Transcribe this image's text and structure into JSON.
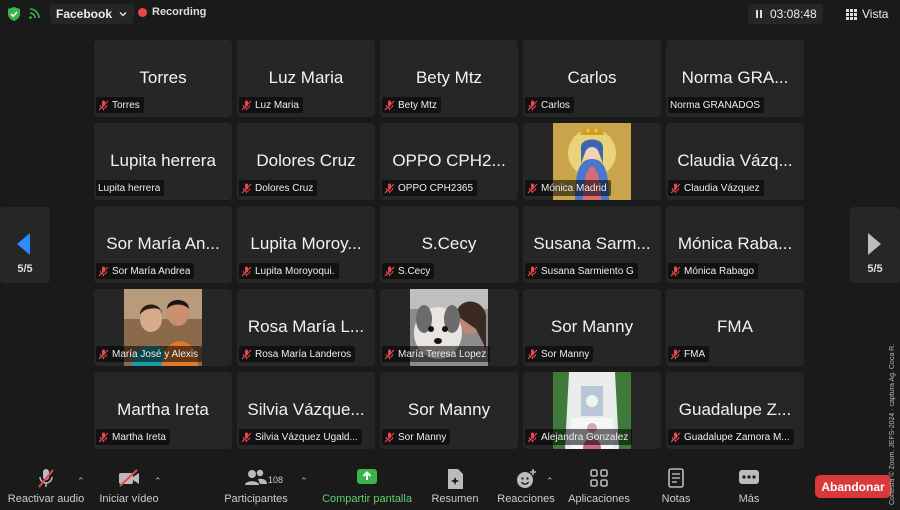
{
  "topbar": {
    "app_name": "Facebook",
    "recording_label": "Recording",
    "timer": "03:08:48",
    "view_label": "Vista"
  },
  "pagination": {
    "left_label": "5/5",
    "right_label": "5/5"
  },
  "participants": [
    {
      "big": "Torres",
      "label": "Torres",
      "muted": true
    },
    {
      "big": "Luz Maria",
      "label": "Luz Maria",
      "muted": true
    },
    {
      "big": "Bety Mtz",
      "label": "Bety Mtz",
      "muted": true
    },
    {
      "big": "Carlos",
      "label": "Carlos",
      "muted": true
    },
    {
      "big": "Norma GRA...",
      "label": "Norma GRANADOS",
      "muted": false
    },
    {
      "big": "Lupita herrera",
      "label": "Lupita herrera",
      "muted": false
    },
    {
      "big": "Dolores Cruz",
      "label": "Dolores Cruz",
      "muted": true
    },
    {
      "big": "OPPO CPH2...",
      "label": "OPPO CPH2365",
      "muted": true
    },
    {
      "big": "",
      "label": "Mónica Madrid",
      "muted": true,
      "photo": "virgin-mary"
    },
    {
      "big": "Claudia Vázq...",
      "label": "Claudia Vázquez",
      "muted": true
    },
    {
      "big": "Sor María An...",
      "label": "Sor María Andrea",
      "muted": true
    },
    {
      "big": "Lupita Moroy...",
      "label": "Lupita Moroyoqui.",
      "muted": true
    },
    {
      "big": "S.Cecy",
      "label": "S.Cecy",
      "muted": true
    },
    {
      "big": "Susana Sarm...",
      "label": "Susana Sarmiento G",
      "muted": true
    },
    {
      "big": "Mónica Raba...",
      "label": "Mónica Rabago",
      "muted": true
    },
    {
      "big": "",
      "label": "María José y Alexis",
      "muted": true,
      "photo": "couple"
    },
    {
      "big": "Rosa María L...",
      "label": "Rosa María Landeros",
      "muted": true
    },
    {
      "big": "",
      "label": "María Teresa Lopez",
      "muted": true,
      "photo": "dog"
    },
    {
      "big": "Sor Manny",
      "label": "Sor Manny",
      "muted": true
    },
    {
      "big": "FMA",
      "label": "FMA",
      "muted": true
    },
    {
      "big": "Martha Ireta",
      "label": "Martha Ireta",
      "muted": true
    },
    {
      "big": "Silvia Vázque...",
      "label": "Silvia Vázquez Ugald...",
      "muted": true
    },
    {
      "big": "Sor Manny",
      "label": "Sor Manny",
      "muted": true
    },
    {
      "big": "",
      "label": "Alejandra Gonzalez",
      "muted": true,
      "photo": "altar"
    },
    {
      "big": "Guadalupe Z...",
      "label": "Guadalupe Zamora M...",
      "muted": true
    }
  ],
  "toolbar": {
    "unmute": "Reactivar audio",
    "start_video": "Iniciar vídeo",
    "participants": "Participantes",
    "participant_count": "108",
    "share": "Compartir pantalla",
    "summary": "Resumen",
    "reactions": "Reacciones",
    "apps": "Aplicaciones",
    "notes": "Notas",
    "more": "Más",
    "leave": "Abandonar"
  },
  "credit": "Cortesía © Zoom. JEFS-2024 · captura Ag. Coca R.",
  "colors": {
    "recording": "#e5484d",
    "share_green": "#5dd06a",
    "leave_red": "#d83a3a",
    "tile_bg": "#262626"
  }
}
